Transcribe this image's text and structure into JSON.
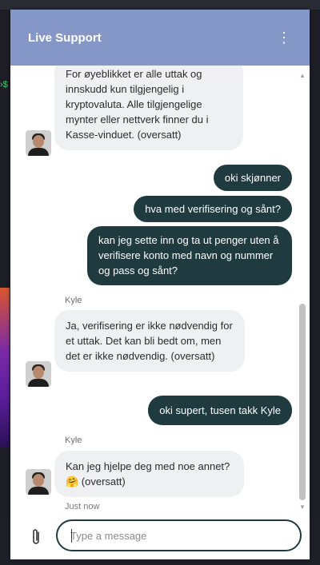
{
  "header": {
    "title": "Live Support",
    "menu_icon": "more-vertical-icon"
  },
  "messages": [
    {
      "from": "agent",
      "text": "For øyeblikket er alle uttak og innskudd kun tilgjengelig i kryptovaluta. Alle tilgjengelige mynter eller nettverk finner du i Kasse-vinduet. (oversatt)"
    },
    {
      "from": "user",
      "text": "oki skjønner"
    },
    {
      "from": "user",
      "text": "hva med verifisering og sånt?"
    },
    {
      "from": "user",
      "text": "kan jeg sette inn og ta ut penger uten å verifisere konto med navn og nummer og pass og sånt?"
    },
    {
      "from": "agent",
      "sender": "Kyle",
      "text": "Ja, verifisering er ikke nødvendig for et uttak. Det kan bli bedt om, men det er ikke nødvendig. (oversatt)"
    },
    {
      "from": "user",
      "text": "oki supert, tusen takk Kyle"
    },
    {
      "from": "agent",
      "sender": "Kyle",
      "text": "Kan jeg hjelpe deg med noe annet? 🤗 (oversatt)",
      "time": "Just now"
    }
  ],
  "composer": {
    "placeholder": "Type a message",
    "attach_icon": "paperclip-icon"
  },
  "colors": {
    "header": "#8497c6",
    "user_bubble": "#1f3b40",
    "agent_bubble": "#eef0f2"
  }
}
